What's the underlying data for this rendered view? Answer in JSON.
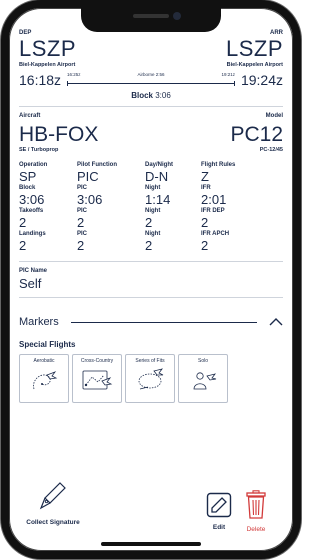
{
  "route": {
    "dep_label": "DEP",
    "arr_label": "ARR",
    "dep_code": "LSZP",
    "arr_code": "LSZP",
    "dep_name": "Biel-Kappelen Airport",
    "arr_name": "Biel-Kappelen Airport",
    "off_block": "16:18z",
    "on_block": "19:24z",
    "takeoff_time": "16:25z",
    "airborne": "Airborne 2:56",
    "landing_time": "19:21z",
    "block_label": "Block",
    "block_value": "3:06"
  },
  "aircraft": {
    "label": "Aircraft",
    "model_label": "Model",
    "registration": "HB-FOX",
    "model": "PC12",
    "class": "SE / Turboprop",
    "variant": "PC-12/45"
  },
  "times": [
    {
      "label": "Operation",
      "value": "SP"
    },
    {
      "label": "Pilot Function",
      "value": "PIC"
    },
    {
      "label": "Day/Night",
      "value": "D-N"
    },
    {
      "label": "Flight Rules",
      "value": "Z"
    },
    {
      "label": "Block",
      "value": "3:06"
    },
    {
      "label": "PIC",
      "value": "3:06"
    },
    {
      "label": "Night",
      "value": "1:14"
    },
    {
      "label": "IFR",
      "value": "2:01"
    },
    {
      "label": "Takeoffs",
      "value": "2"
    },
    {
      "label": "PIC",
      "value": "2"
    },
    {
      "label": "Night",
      "value": "2"
    },
    {
      "label": "IFR DEP",
      "value": "2"
    },
    {
      "label": "Landings",
      "value": "2"
    },
    {
      "label": "PIC",
      "value": "2"
    },
    {
      "label": "Night",
      "value": "2"
    },
    {
      "label": "IFR APCH",
      "value": "2"
    }
  ],
  "pic": {
    "label": "PIC Name",
    "value": "Self"
  },
  "markers": {
    "title": "Markers",
    "icon": "chevron-up-icon"
  },
  "special_flights": {
    "title": "Special Flights",
    "items": [
      {
        "name": "Aerobatic",
        "icon": "aerobatic-plane-icon"
      },
      {
        "name": "Cross-Country",
        "icon": "cross-country-route-icon"
      },
      {
        "name": "Series of Fits",
        "icon": "series-of-fits-icon"
      },
      {
        "name": "Solo",
        "icon": "solo-pilot-icon"
      }
    ]
  },
  "actions": {
    "collect_label": "Collect Signature",
    "edit_label": "Edit",
    "delete_label": "Delete",
    "delete_color": "#d23a3a",
    "text_color": "#1b2a4a"
  }
}
